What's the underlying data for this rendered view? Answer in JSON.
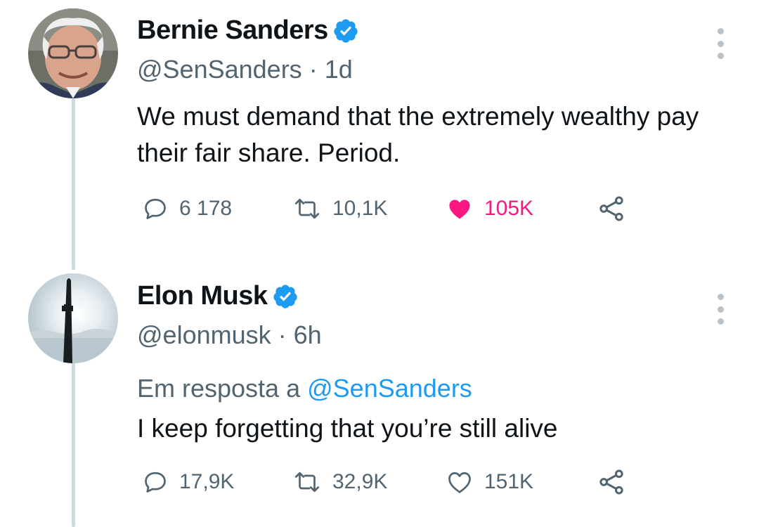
{
  "tweets": [
    {
      "author_name": "Bernie Sanders",
      "handle": "@SenSanders",
      "separator": "·",
      "time": "1d",
      "reply_prefix": "",
      "reply_mention": "",
      "text": "We must demand that the extremely wealthy pay their fair share. Period.",
      "stats": {
        "replies": "6 178",
        "retweets": "10,1K",
        "likes": "105K",
        "liked": true
      },
      "avatar_icon": "bernie-sanders-avatar"
    },
    {
      "author_name": "Elon Musk",
      "handle": "@elonmusk",
      "separator": "·",
      "time": "6h",
      "reply_prefix": "Em resposta a",
      "reply_mention": "@SenSanders",
      "text": "I keep forgetting that you’re still alive",
      "stats": {
        "replies": "17,9K",
        "retweets": "32,9K",
        "likes": "151K",
        "liked": false
      },
      "avatar_icon": "starship-avatar"
    }
  ],
  "colors": {
    "text": "#0f1419",
    "secondary": "#536471",
    "accent": "#1d9bf0",
    "like": "#f91880",
    "thread_line": "#cfd9de"
  },
  "icons": [
    "verified-badge-icon",
    "reply-icon",
    "retweet-icon",
    "like-icon",
    "share-icon",
    "more-icon"
  ]
}
